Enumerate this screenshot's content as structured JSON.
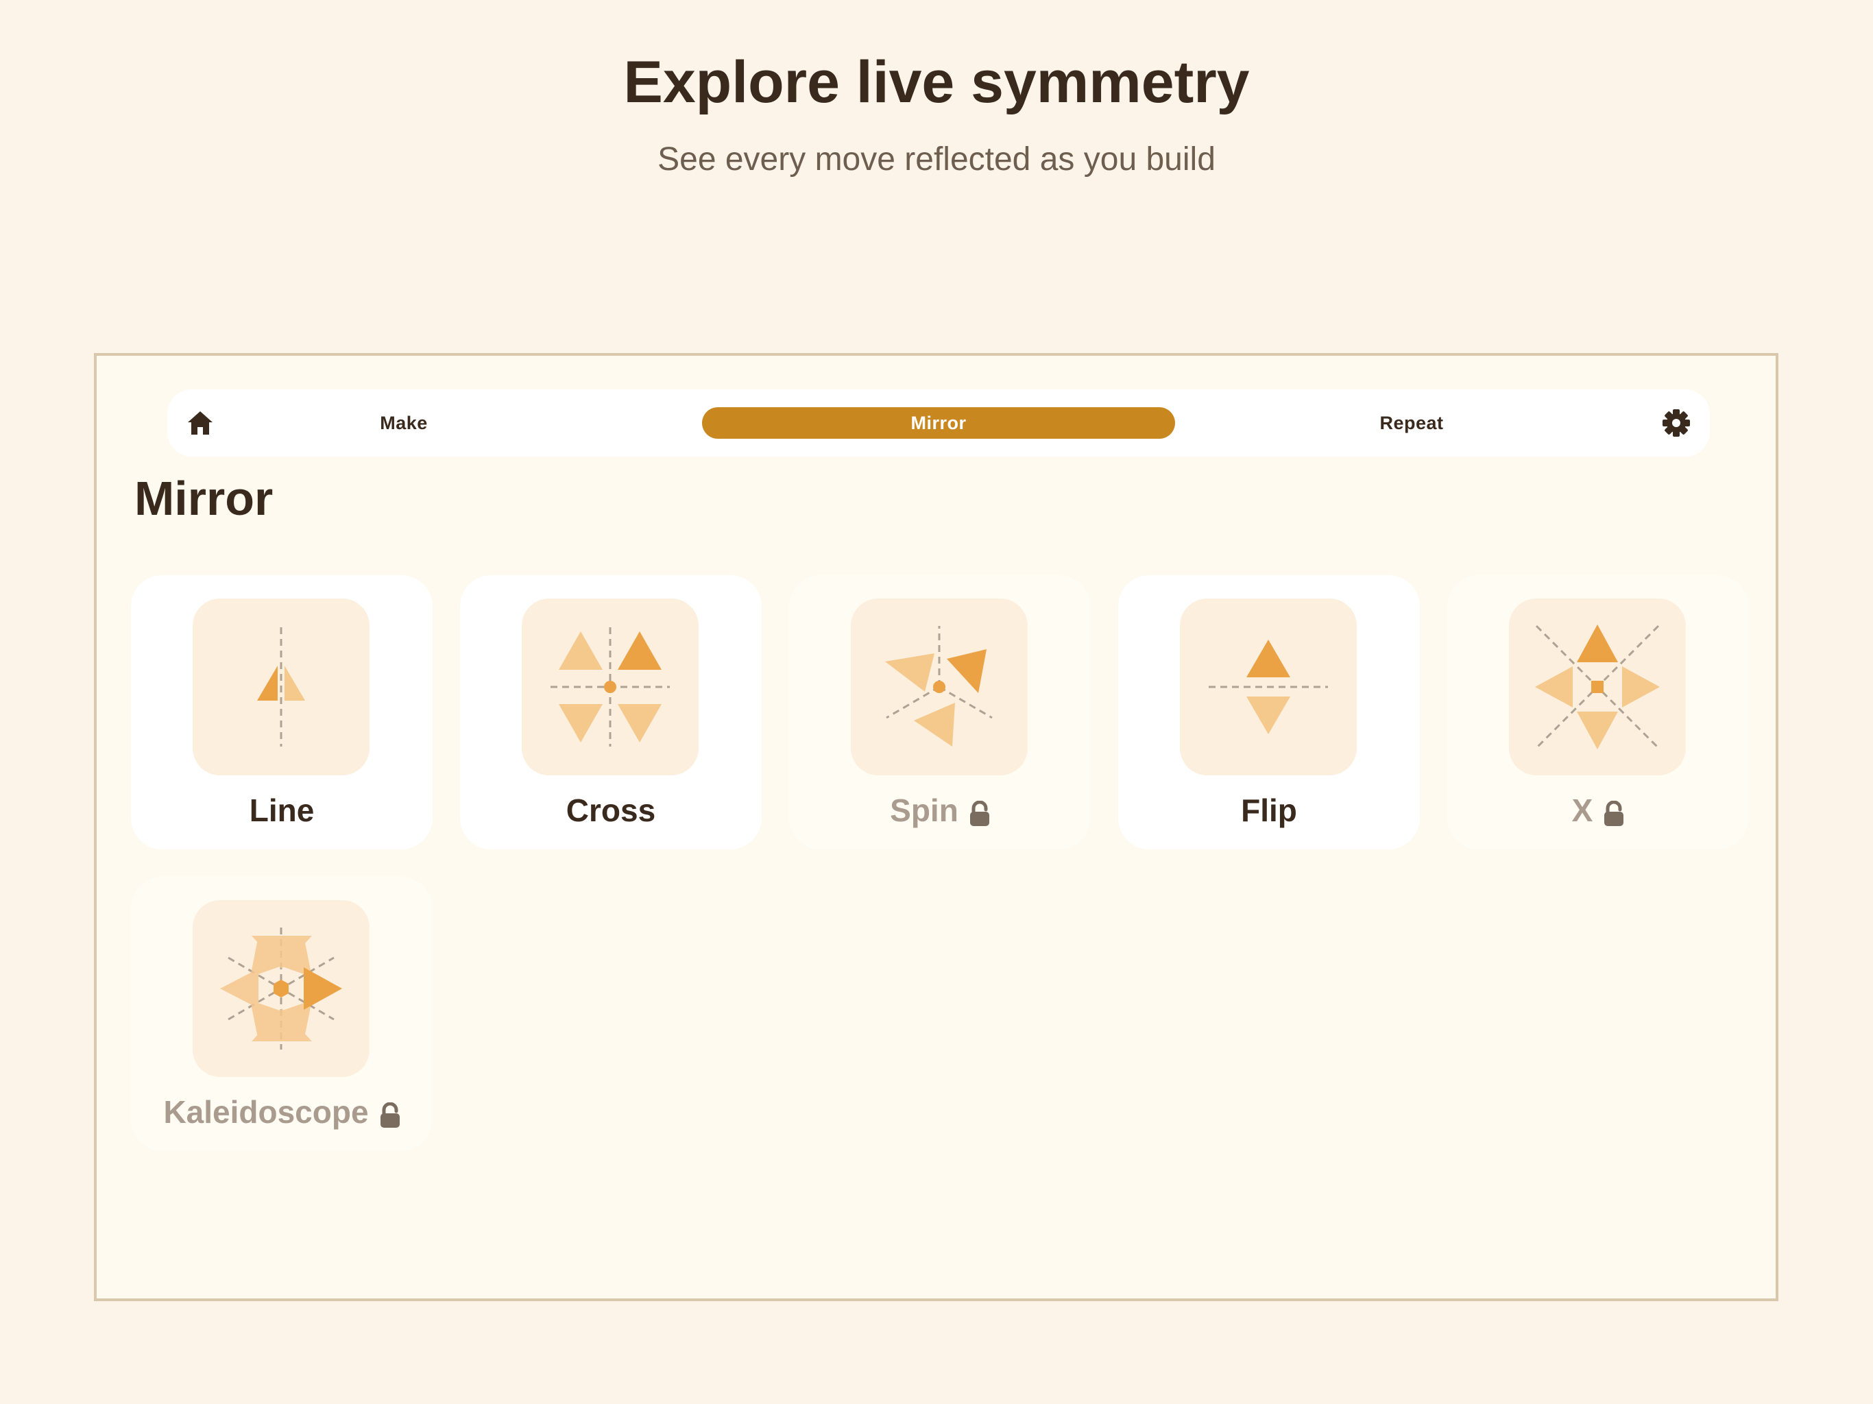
{
  "hero": {
    "title": "Explore live symmetry",
    "subtitle": "See every move reflected as you build"
  },
  "nav": {
    "home_icon": "home-icon",
    "tabs": [
      {
        "label": "Make",
        "active": false
      },
      {
        "label": "Mirror",
        "active": true
      },
      {
        "label": "Repeat",
        "active": false
      }
    ],
    "settings_icon": "gear-icon"
  },
  "section": {
    "title": "Mirror"
  },
  "modes": [
    {
      "label": "Line",
      "locked": false,
      "icon": "line-symmetry-icon"
    },
    {
      "label": "Cross",
      "locked": false,
      "icon": "cross-symmetry-icon"
    },
    {
      "label": "Spin",
      "locked": true,
      "icon": "spin-symmetry-icon"
    },
    {
      "label": "Flip",
      "locked": false,
      "icon": "flip-symmetry-icon"
    },
    {
      "label": "X",
      "locked": true,
      "icon": "x-symmetry-icon"
    },
    {
      "label": "Kaleidoscope",
      "locked": true,
      "icon": "kaleidoscope-symmetry-icon"
    }
  ],
  "colors": {
    "background": "#fcf4e8",
    "accent": "#c98720",
    "shape_dark": "#eba244",
    "shape_light": "#f5c88c",
    "text": "#3a2a1e",
    "locked_text": "#a99c8e"
  }
}
